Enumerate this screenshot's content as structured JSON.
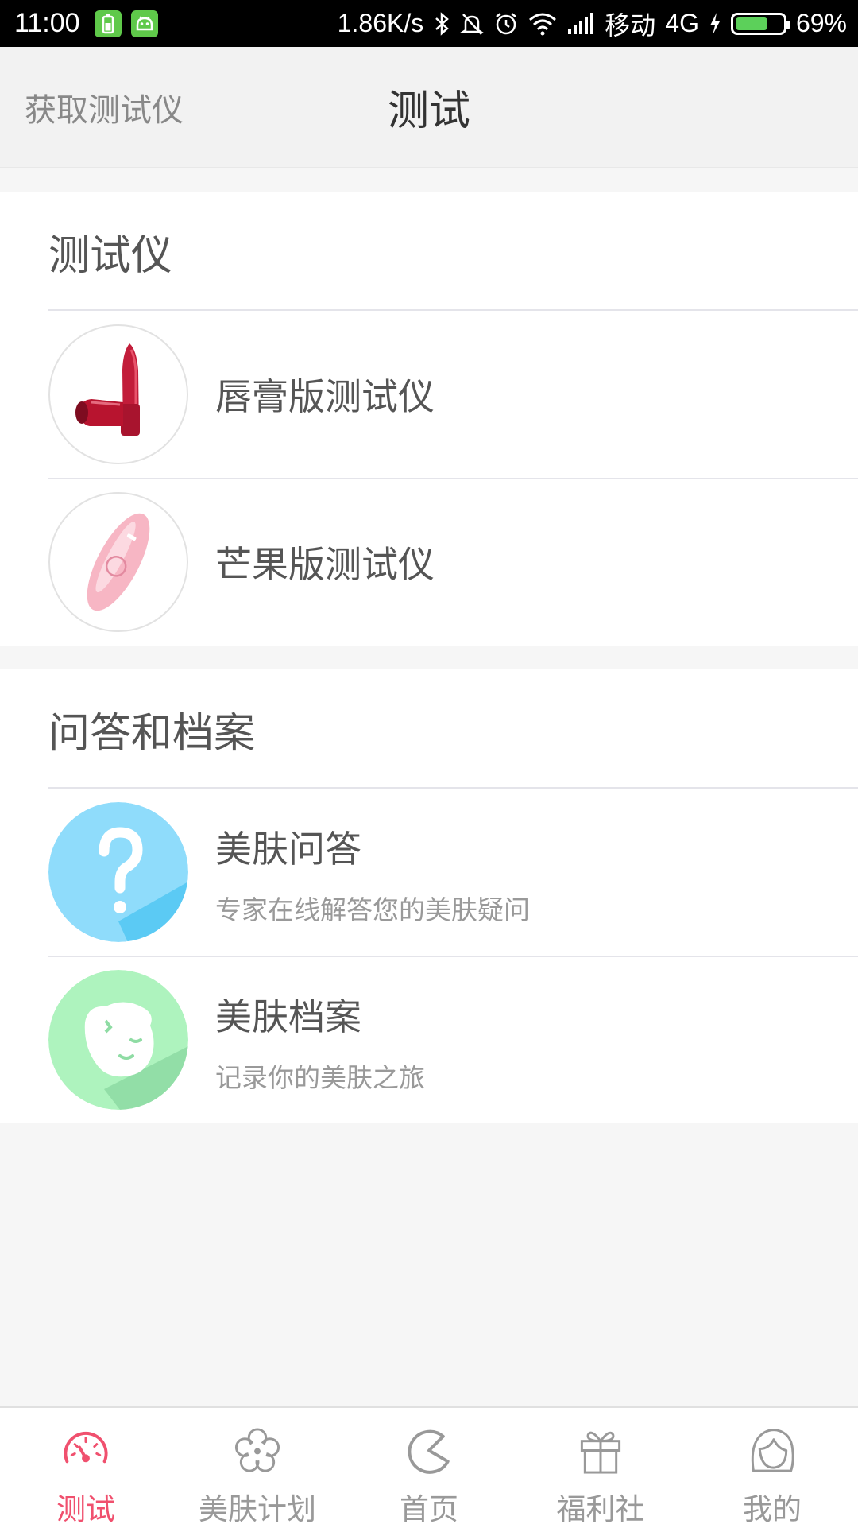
{
  "status_bar": {
    "time": "11:00",
    "speed": "1.86K/s",
    "carrier": "移动",
    "network": "4G",
    "battery_percent": "69%",
    "battery_level": 0.69
  },
  "header": {
    "left_link": "获取测试仪",
    "title": "测试"
  },
  "section_devices": {
    "title": "测试仪",
    "items": [
      {
        "label": "唇膏版测试仪",
        "icon": "lipstick-device-image"
      },
      {
        "label": "芒果版测试仪",
        "icon": "mango-device-image"
      }
    ]
  },
  "section_qa": {
    "title": "问答和档案",
    "items": [
      {
        "label": "美肤问答",
        "sub": "专家在线解答您的美肤疑问",
        "icon": "question-icon",
        "color": "#5fcdf7"
      },
      {
        "label": "美肤档案",
        "sub": "记录你的美肤之旅",
        "icon": "face-icon",
        "color": "#8de7a7"
      }
    ]
  },
  "tabbar": {
    "active_color": "#f0506e",
    "tabs": [
      {
        "label": "测试",
        "icon": "speedometer-icon",
        "active": true
      },
      {
        "label": "美肤计划",
        "icon": "flower-icon",
        "active": false
      },
      {
        "label": "首页",
        "icon": "home-pacman-icon",
        "active": false
      },
      {
        "label": "福利社",
        "icon": "gift-icon",
        "active": false
      },
      {
        "label": "我的",
        "icon": "profile-girl-icon",
        "active": false
      }
    ]
  }
}
